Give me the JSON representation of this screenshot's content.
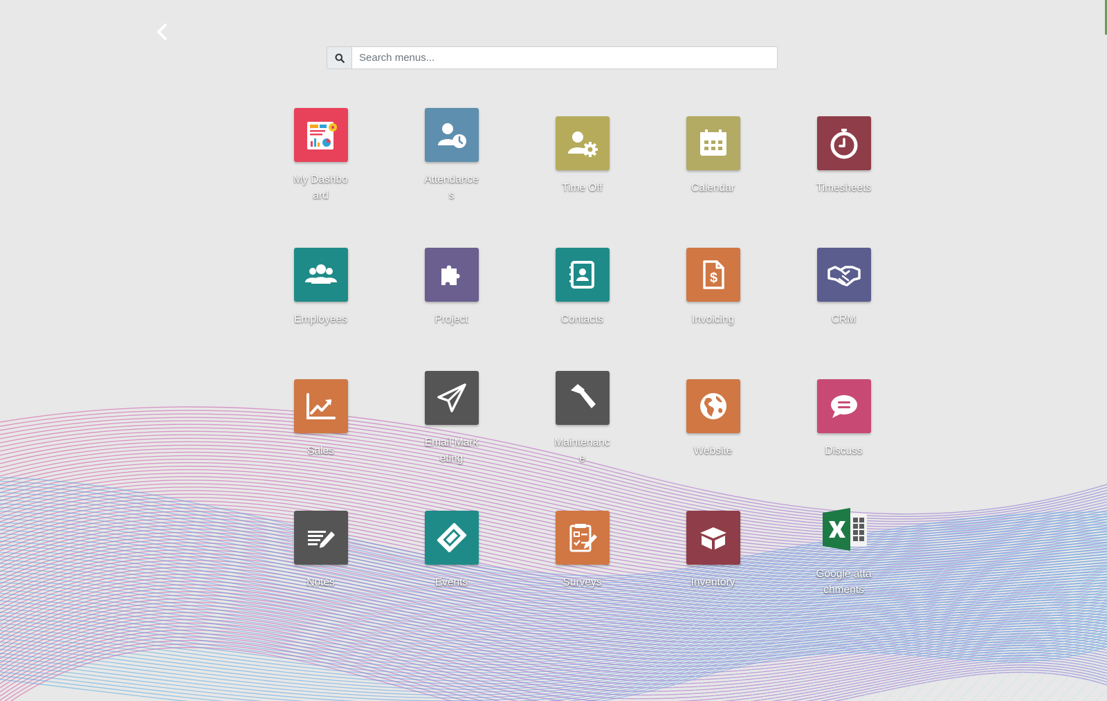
{
  "search": {
    "placeholder": "Search menus...",
    "value": ""
  },
  "apps": [
    {
      "label": "My Dashboard",
      "icon": "dashboard-icon",
      "color": "#e8425b"
    },
    {
      "label": "Attendances",
      "icon": "attendance-icon",
      "color": "#5f8fae"
    },
    {
      "label": "Time Off",
      "icon": "time-off-icon",
      "color": "#b5ab5b"
    },
    {
      "label": "Calendar",
      "icon": "calendar-icon",
      "color": "#b3aa63"
    },
    {
      "label": "Timesheets",
      "icon": "stopwatch-icon",
      "color": "#8f3d48"
    },
    {
      "label": "Employees",
      "icon": "employees-icon",
      "color": "#1f8b88"
    },
    {
      "label": "Project",
      "icon": "puzzle-icon",
      "color": "#6a5f8f"
    },
    {
      "label": "Contacts",
      "icon": "contacts-icon",
      "color": "#1f8b88"
    },
    {
      "label": "Invoicing",
      "icon": "invoice-icon",
      "color": "#d07744"
    },
    {
      "label": "CRM",
      "icon": "handshake-icon",
      "color": "#5a5d8e"
    },
    {
      "label": "Sales",
      "icon": "sales-chart-icon",
      "color": "#d07744"
    },
    {
      "label": "Email Marketing",
      "icon": "paper-plane-icon",
      "color": "#555555"
    },
    {
      "label": "Maintenance",
      "icon": "hammer-icon",
      "color": "#555555"
    },
    {
      "label": "Website",
      "icon": "globe-icon",
      "color": "#d07744"
    },
    {
      "label": "Discuss",
      "icon": "chat-bubble-icon",
      "color": "#c84a74"
    },
    {
      "label": "Notes",
      "icon": "notes-icon",
      "color": "#555555"
    },
    {
      "label": "Events",
      "icon": "ticket-icon",
      "color": "#1f8b88"
    },
    {
      "label": "Surveys",
      "icon": "survey-icon",
      "color": "#d07744"
    },
    {
      "label": "Inventory",
      "icon": "box-icon",
      "color": "#8f3d48"
    },
    {
      "label": "Google attachments",
      "icon": "excel-icon",
      "color": "#1d7a45"
    }
  ]
}
